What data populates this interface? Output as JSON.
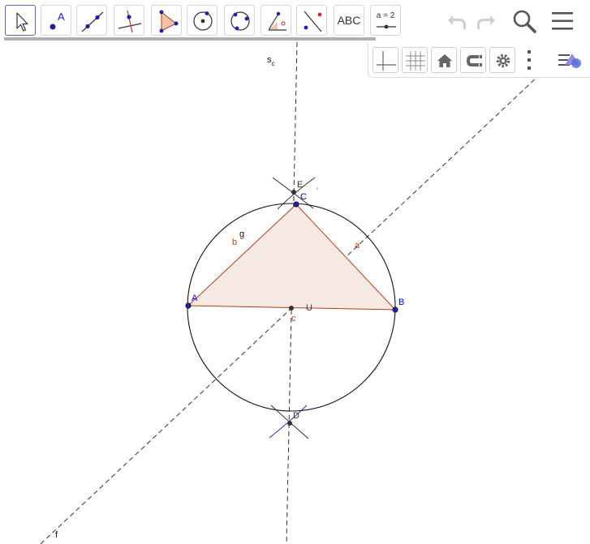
{
  "toolbar": {
    "tools": [
      {
        "name": "move-tool",
        "icon": "arrow-cursor-icon",
        "selected": true
      },
      {
        "name": "point-tool",
        "icon": "point-icon",
        "label": "A"
      },
      {
        "name": "line-tool",
        "icon": "line-icon"
      },
      {
        "name": "perpendicular-line-tool",
        "icon": "perpendicular-line-icon"
      },
      {
        "name": "polygon-tool",
        "icon": "polygon-icon"
      },
      {
        "name": "circle-center-point-tool",
        "icon": "circle-center-icon"
      },
      {
        "name": "circle-three-points-tool",
        "icon": "circle-three-points-icon"
      },
      {
        "name": "angle-tool",
        "icon": "angle-icon"
      },
      {
        "name": "reflect-tool",
        "icon": "reflect-icon"
      },
      {
        "name": "text-tool",
        "icon": "text-icon",
        "label": "ABC"
      },
      {
        "name": "slider-tool",
        "icon": "slider-icon",
        "label": "a = 2"
      }
    ],
    "right_buttons": [
      "undo-icon",
      "redo-icon",
      "search-icon",
      "menu-icon"
    ]
  },
  "style_bar": {
    "buttons": [
      "axes-icon",
      "grid-icon",
      "home-icon",
      "magnet-icon",
      "gear-icon",
      "more-vertical-icon",
      "style-bar-toggle-icon"
    ]
  },
  "colors": {
    "accent": "#6557d2",
    "point": "#1f1fb0",
    "polygon_fill": "#f6e8e3",
    "polygon_edge": "#b43c14",
    "segment_label": "#b04a1c",
    "point_label": "#0000cc",
    "dark_point": "#333333"
  },
  "construction": {
    "points": {
      "A": "A",
      "B": "B",
      "C": "C",
      "D": "D",
      "E": "E",
      "U": "U"
    },
    "segments": {
      "a": "a",
      "b": "b",
      "c": "c"
    },
    "labels": {
      "g": "g",
      "f": "f",
      "sc": "s",
      "sc_sub": "c",
      "stray": "'"
    }
  }
}
